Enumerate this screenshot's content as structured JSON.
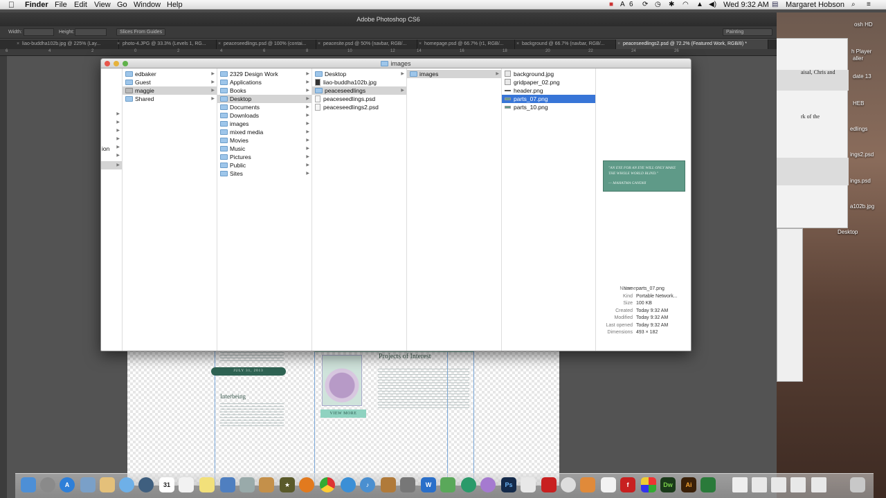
{
  "menubar": {
    "app": "Finder",
    "items": [
      "File",
      "Edit",
      "View",
      "Go",
      "Window",
      "Help"
    ],
    "status_number": "6",
    "clock": "Wed 9:32 AM",
    "user": "Margaret Hobson"
  },
  "photoshop": {
    "title": "Adobe Photoshop CS6",
    "options": {
      "width_label": "Width:",
      "height_label": "Height:",
      "slices_button": "Slices From Guides",
      "workspace": "Painting"
    },
    "tabs": [
      "liao-buddha102b.jpg @ 225% (Lay...",
      "photo-4.JPG @ 33.3% (Levels 1, RG...",
      "peaceseedlings.psd @ 100% (contai...",
      "peacesite.psd @ 50% (navbar, RGB/...",
      "homepage.psd @ 66.7% (r1, RGB/...",
      "background @ 66.7% (navbar, RGB/...",
      "peaceseedlings2.psd @ 72.2% (Featured Work, RGB/8) *"
    ],
    "ruler_ticks": [
      "6",
      "4",
      "2",
      "0",
      "2",
      "4",
      "6",
      "8",
      "10",
      "12",
      "14",
      "16",
      "18",
      "20",
      "22",
      "24",
      "26"
    ],
    "canvas": {
      "date": "JULY 31, 2013",
      "heading_left": "Interbeing",
      "heading_right": "Projects of Interest",
      "view_more": "VIEW MORE"
    }
  },
  "finder": {
    "title": "images",
    "sidebar_fragment": "ion",
    "columns": [
      {
        "items": [
          {
            "label": "edbaker",
            "type": "folder",
            "arrow": true
          },
          {
            "label": "Guest",
            "type": "folder",
            "arrow": true
          },
          {
            "label": "maggie",
            "type": "home",
            "arrow": true,
            "selected": "gray"
          },
          {
            "label": "Shared",
            "type": "folder",
            "arrow": true
          }
        ]
      },
      {
        "items": [
          {
            "label": "2329 Design Work",
            "type": "folder",
            "arrow": true
          },
          {
            "label": "Applications",
            "type": "folder",
            "arrow": true
          },
          {
            "label": "Books",
            "type": "folder",
            "arrow": true
          },
          {
            "label": "Desktop",
            "type": "folder",
            "arrow": true,
            "selected": "gray"
          },
          {
            "label": "Documents",
            "type": "folder",
            "arrow": true
          },
          {
            "label": "Downloads",
            "type": "folder",
            "arrow": true
          },
          {
            "label": "images",
            "type": "folder",
            "arrow": true
          },
          {
            "label": "mixed media",
            "type": "folder",
            "arrow": true
          },
          {
            "label": "Movies",
            "type": "folder",
            "arrow": true
          },
          {
            "label": "Music",
            "type": "folder",
            "arrow": true
          },
          {
            "label": "Pictures",
            "type": "folder",
            "arrow": true
          },
          {
            "label": "Public",
            "type": "folder",
            "arrow": true
          },
          {
            "label": "Sites",
            "type": "folder",
            "arrow": true
          }
        ]
      },
      {
        "items": [
          {
            "label": "Desktop",
            "type": "folder",
            "arrow": true
          },
          {
            "label": "liao-buddha102b.jpg",
            "type": "file",
            "arrow": false
          },
          {
            "label": "peaceseedlings",
            "type": "folder",
            "arrow": true,
            "selected": "gray"
          },
          {
            "label": "peaceseedlings.psd",
            "type": "file",
            "arrow": false
          },
          {
            "label": "peaceseedlings2.psd",
            "type": "file",
            "arrow": false
          }
        ]
      },
      {
        "items": [
          {
            "label": "images",
            "type": "folder",
            "arrow": true,
            "selected": "gray"
          }
        ]
      },
      {
        "items": [
          {
            "label": "background.jpg",
            "type": "image",
            "arrow": false
          },
          {
            "label": "gridpaper_02.png",
            "type": "image",
            "arrow": false
          },
          {
            "label": "header.png",
            "type": "image",
            "arrow": false
          },
          {
            "label": "parts_07.png",
            "type": "image",
            "arrow": false,
            "selected": "blue"
          },
          {
            "label": "parts_10.png",
            "type": "image",
            "arrow": false
          }
        ]
      }
    ],
    "preview": {
      "quote": "\"AN EYE FOR AN EYE WILL ONLY MAKE THE WHOLE WORLD BLIND.\"",
      "attribution": "— MAHATMA GANDHI"
    },
    "info": [
      {
        "key": "Name",
        "value": "parts_07.png"
      },
      {
        "key": "Kind",
        "value": "Portable Network..."
      },
      {
        "key": "Size",
        "value": "100 KB"
      },
      {
        "key": "Created",
        "value": "Today 9:32 AM"
      },
      {
        "key": "Modified",
        "value": "Today 9:32 AM"
      },
      {
        "key": "Last opened",
        "value": "Today 9:32 AM"
      },
      {
        "key": "Dimensions",
        "value": "493 × 182"
      }
    ]
  },
  "background_window": {
    "lines": [
      "aisal, Chris and",
      "rk of the"
    ]
  },
  "desktop_labels": [
    "osh HD",
    "h Player",
    "aller",
    "date 13",
    "HEB",
    "edlings",
    "ings2.psd",
    "ings.psd",
    "a102b.jpg",
    "Desktop"
  ],
  "dock": {
    "calendar_date": "31",
    "items": [
      "finder-icon",
      "launchpad-icon",
      "app-store-icon",
      "mail-icon",
      "notes-icon",
      "messages-icon",
      "itunes-icon",
      "calendar-icon",
      "textedit-icon",
      "stickies-icon",
      "photos-icon",
      "script-icon",
      "preview-icon",
      "chess-icon",
      "firefox-icon",
      "chrome-icon",
      "safari-icon",
      "music-icon",
      "guitar-icon",
      "utility-icon",
      "word-icon",
      "network-icon",
      "globe-icon",
      "purple-icon",
      "photoshop-icon",
      "document-icon",
      "acrobat-icon",
      "gear-icon",
      "pen-icon",
      "pdf-icon",
      "flash-icon",
      "grid-icon",
      "dreamweaver-icon",
      "illustrator-icon",
      "excel-icon",
      "folder-icon",
      "window1-icon",
      "window2-icon",
      "window3-icon",
      "window4-icon",
      "trash-icon"
    ]
  }
}
